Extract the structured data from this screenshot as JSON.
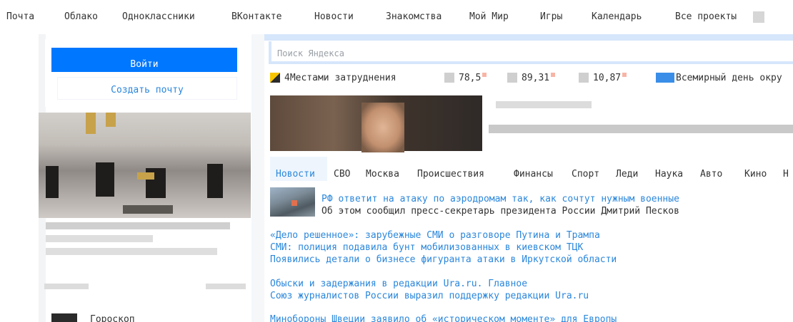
{
  "topnav": {
    "items": [
      "Почта",
      "Облако",
      "Одноклассники",
      "ВКонтакте",
      "Новости",
      "Знакомства",
      "Мой Мир",
      "Игры",
      "Календарь",
      "Все проекты"
    ]
  },
  "login": {
    "login_label": "Войти",
    "create_label": "Создать почту"
  },
  "sidebar": {
    "horoscope_label": "Гороскоп"
  },
  "search": {
    "placeholder": "Поиск Яндекса"
  },
  "info": {
    "headline": "4Местами затруднения",
    "rate1": "78,5",
    "rate2": "89,31",
    "rate3": "10,87",
    "event": "Всемирный день окру"
  },
  "news_tabs": [
    "Новости",
    "СВО",
    "Москва",
    "Происшествия",
    "Финансы",
    "Спорт",
    "Леди",
    "Наука",
    "Авто",
    "Кино",
    "Н"
  ],
  "news": {
    "top_title": "РФ ответит на атаку по аэродромам так, как сочтут нужным военные",
    "top_sub": "Об этом сообщил пресс-секретарь президента России Дмитрий Песков",
    "g1": [
      "«Дело решенное»: зарубежные СМИ о разговоре Путина и Трампа",
      "СМИ: полиция подавила бунт мобилизованных в киевском ТЦК",
      "Появились детали о бизнесе фигуранта атаки в Иркутской области"
    ],
    "g2": [
      "Обыски и задержания в редакции Ura.ru. Главное",
      "Союз журналистов России выразил поддержку редакции Ura.ru"
    ],
    "g3": [
      "Минобороны Швеции заявило об «историческом моменте» для Европы"
    ]
  },
  "colors": {
    "accent": "#0077ff",
    "link": "#2b87db"
  }
}
